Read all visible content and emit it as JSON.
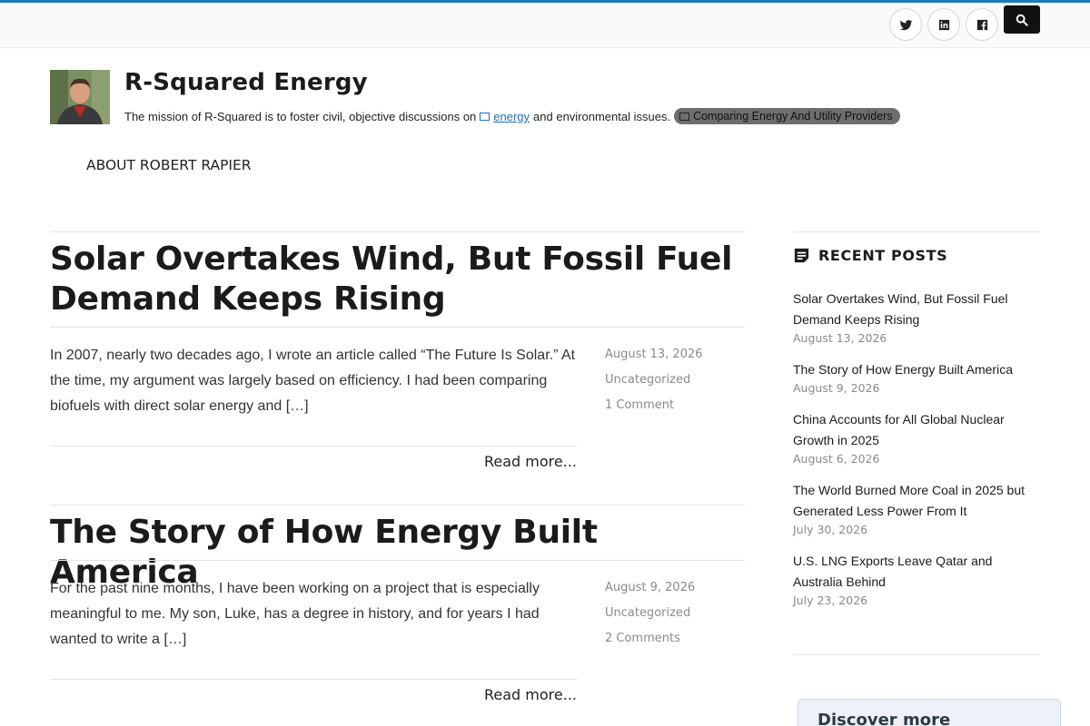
{
  "header": {
    "social": [
      {
        "name": "twitter-icon"
      },
      {
        "name": "linkedin-icon"
      },
      {
        "name": "facebook-icon"
      }
    ],
    "search_icon": "search-icon"
  },
  "site": {
    "title": "R-Squared Energy",
    "tagline_before": "The mission of R-Squared is to foster civil, objective discussions on",
    "tagline_link": "energy",
    "tagline_after": "and environmental issues.",
    "tagline_pill": "Comparing Energy And Utility Providers"
  },
  "nav": {
    "about": "ABOUT ROBERT RAPIER"
  },
  "posts": [
    {
      "title": "Solar Overtakes Wind, But Fossil Fuel Demand Keeps Rising",
      "excerpt": "In 2007, nearly two decades ago, I wrote an article called “The Future Is Solar.” At the time, my argument was largely based on efficiency. I had been comparing biofuels with direct solar energy and […]",
      "date": "August 13, 2026",
      "category": "Uncategorized",
      "comments": "1 Comment",
      "read_more": "Read more..."
    },
    {
      "title": "The Story of How Energy Built America",
      "excerpt": "For the past nine months, I have been working on a project that is especially meaningful to me. My son, Luke, has a degree in history, and for years I had wanted to write a […]",
      "date": "August 9, 2026",
      "category": "Uncategorized",
      "comments": "2 Comments",
      "read_more": "Read more..."
    }
  ],
  "sidebar": {
    "recent_title": "RECENT POSTS",
    "recent": [
      {
        "title": "Solar Overtakes Wind, But Fossil Fuel Demand Keeps Rising",
        "date": "August 13, 2026"
      },
      {
        "title": "The Story of How Energy Built America",
        "date": "August 9, 2026"
      },
      {
        "title": "China Accounts for All Global Nuclear Growth in 2025",
        "date": "August 6, 2026"
      },
      {
        "title": "The World Burned More Coal in 2025 but Generated Less Power From It",
        "date": "July 30, 2026"
      },
      {
        "title": "U.S. LNG Exports Leave Qatar and Australia Behind",
        "date": "July 23, 2026"
      }
    ],
    "discover": "Discover more"
  },
  "colors": {
    "accent": "#1e7bb8",
    "text": "#1b1b1b",
    "meta": "#8a8a8a"
  }
}
